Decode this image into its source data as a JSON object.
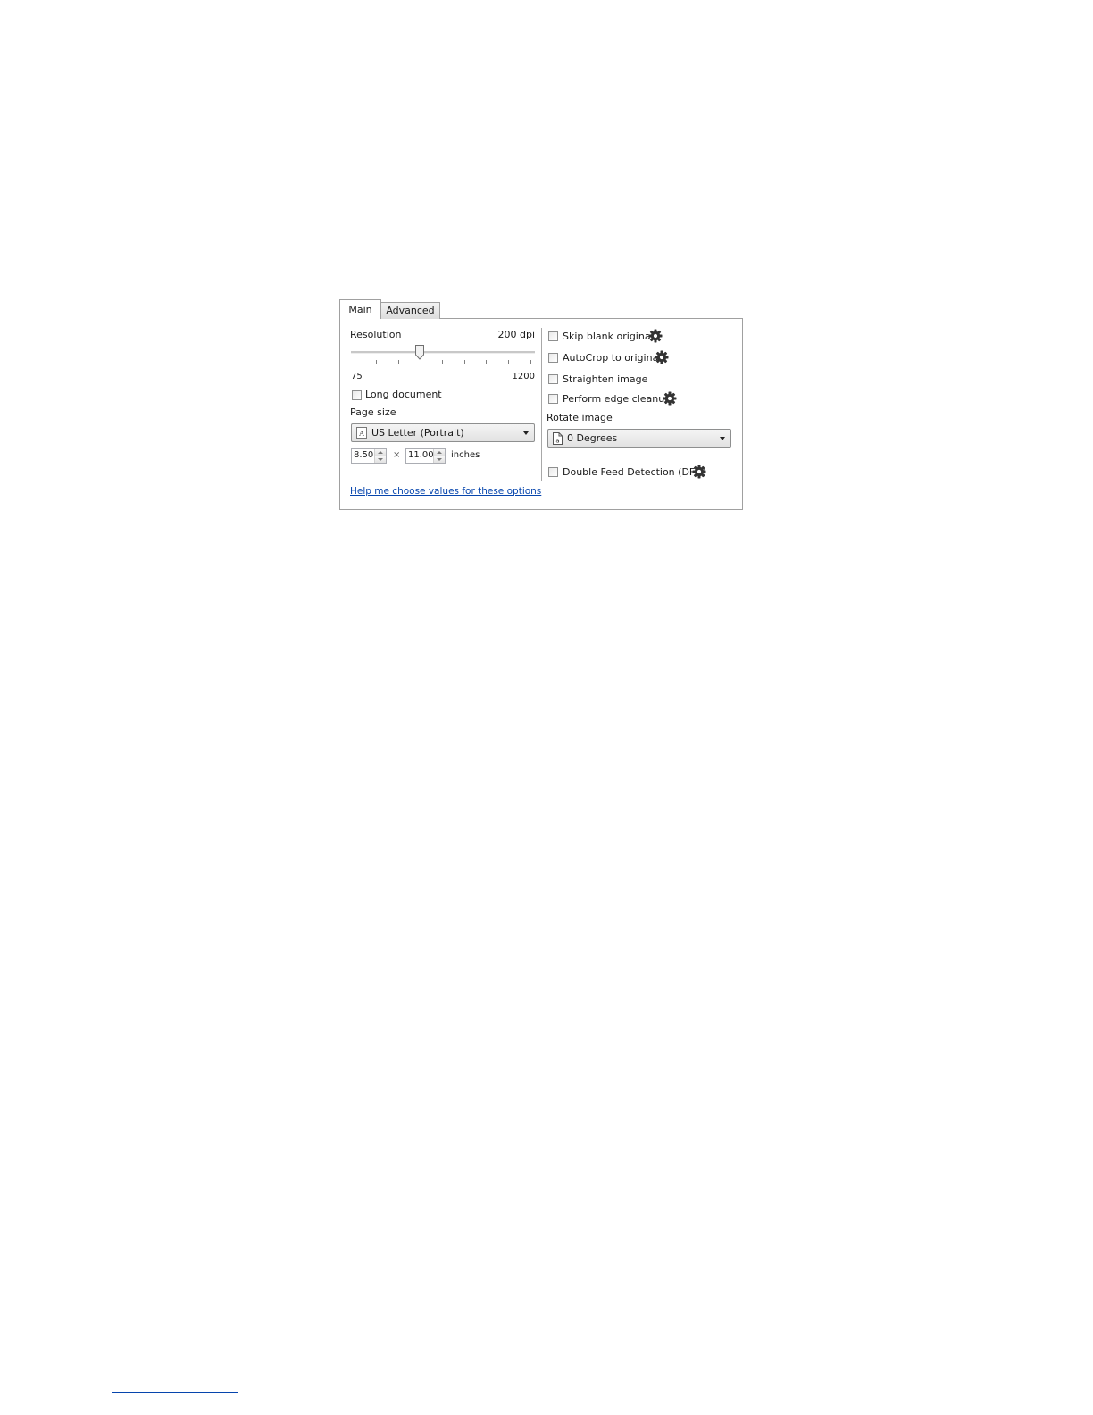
{
  "tabs": [
    {
      "label": "Main",
      "active": true
    },
    {
      "label": "Advanced",
      "active": false
    }
  ],
  "resolution": {
    "label": "Resolution",
    "value_text": "200 dpi",
    "min_label": "75",
    "max_label": "1200",
    "slider_level_fraction": 0.37
  },
  "long_document": {
    "label": "Long document",
    "checked": false
  },
  "page_size": {
    "label": "Page size",
    "selected": "US Letter (Portrait)",
    "icon": "page-letter-icon",
    "width": "8.50",
    "separator": "×",
    "height": "11.00",
    "units": "inches"
  },
  "options": {
    "skip_blank": {
      "label": "Skip blank originals",
      "checked": false,
      "has_settings": true
    },
    "autocrop": {
      "label": "AutoCrop to original",
      "checked": false,
      "has_settings": true
    },
    "straighten": {
      "label": "Straighten image",
      "checked": false,
      "has_settings": false
    },
    "edge_cleanup": {
      "label": "Perform edge cleanup",
      "checked": false,
      "has_settings": true
    }
  },
  "rotate": {
    "label": "Rotate image",
    "selected": "0 Degrees",
    "icon": "rotate-page-icon"
  },
  "dfd": {
    "label": "Double Feed Detection (DFD)",
    "checked": false,
    "has_settings": true
  },
  "help_link": "Help me choose values for these options",
  "colors": {
    "link": "#0645ad",
    "border": "#a0a0a0",
    "gear": "#333333"
  }
}
